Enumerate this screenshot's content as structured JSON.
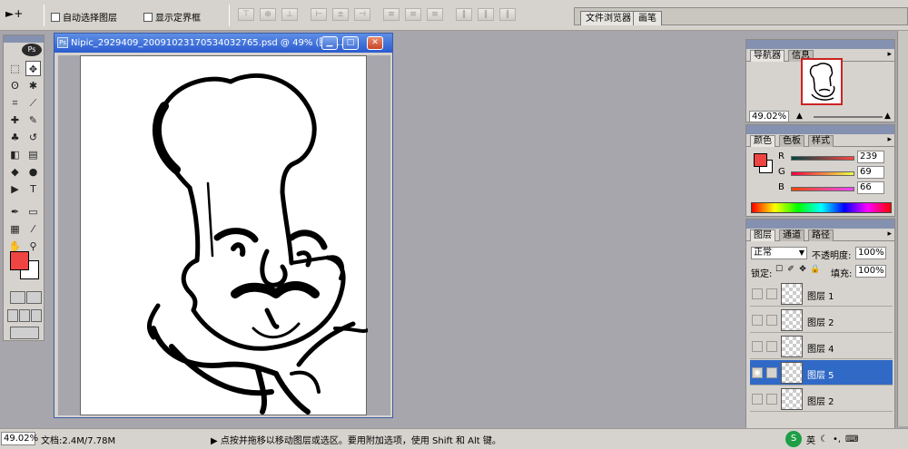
{
  "options_bar": {
    "tool_glyph": "►+",
    "auto_select_label": "自动选择图层",
    "show_bounds_label": "显示定界框",
    "align_buttons": [
      "⊤",
      "⊕",
      "⊥",
      "⊢",
      "±",
      "⊣",
      "≡",
      "≡",
      "≡",
      "‖",
      "‖",
      "‖"
    ],
    "well_tabs": [
      "文件浏览器",
      "画笔"
    ]
  },
  "toolbox": {
    "logo_text": "Ps",
    "tools": [
      {
        "name": "marquee-tool",
        "glyph": "⬚"
      },
      {
        "name": "move-tool",
        "glyph": "✥"
      },
      {
        "name": "lasso-tool",
        "glyph": "ʘ"
      },
      {
        "name": "magic-wand-tool",
        "glyph": "✱"
      },
      {
        "name": "crop-tool",
        "glyph": "⌗"
      },
      {
        "name": "slice-tool",
        "glyph": "⟋"
      },
      {
        "name": "healing-brush-tool",
        "glyph": "✚"
      },
      {
        "name": "brush-tool",
        "glyph": "✎"
      },
      {
        "name": "stamp-tool",
        "glyph": "♣"
      },
      {
        "name": "history-brush-tool",
        "glyph": "↺"
      },
      {
        "name": "eraser-tool",
        "glyph": "◧"
      },
      {
        "name": "gradient-tool",
        "glyph": "▤"
      },
      {
        "name": "blur-tool",
        "glyph": "◆"
      },
      {
        "name": "dodge-tool",
        "glyph": "●"
      },
      {
        "name": "path-selection-tool",
        "glyph": "▶"
      },
      {
        "name": "type-tool",
        "glyph": "T"
      },
      {
        "name": "pen-tool",
        "glyph": "✒"
      },
      {
        "name": "shape-tool",
        "glyph": "▭"
      },
      {
        "name": "notes-tool",
        "glyph": "▦"
      },
      {
        "name": "eyedropper-tool",
        "glyph": "⁄"
      },
      {
        "name": "hand-tool",
        "glyph": "✋"
      },
      {
        "name": "zoom-tool",
        "glyph": "⚲"
      }
    ],
    "foreground_color": "#ef4542",
    "background_color": "#ffffff"
  },
  "document": {
    "title": "Nipic_2929409_20091023170534032765.psd @ 49% (图层...",
    "minimize_glyph": "▁",
    "maximize_glyph": "□",
    "close_glyph": "✕",
    "icon_text": "Ps"
  },
  "navigator": {
    "tabs": [
      "导航器",
      "信息"
    ],
    "zoom": "49.02%"
  },
  "color_panel": {
    "tabs": [
      "颜色",
      "色板",
      "样式"
    ],
    "channels": [
      {
        "label": "R",
        "value": "239"
      },
      {
        "label": "G",
        "value": "69"
      },
      {
        "label": "B",
        "value": "66"
      }
    ]
  },
  "layers_panel": {
    "tabs": [
      "图层",
      "通道",
      "路径"
    ],
    "blend_mode": "正常",
    "opacity_label": "不透明度:",
    "opacity_value": "100%",
    "lock_label": "锁定:",
    "fill_label": "填充:",
    "fill_value": "100%",
    "lock_glyphs": [
      "☐",
      "✐",
      "✥",
      "🔒"
    ],
    "layers": [
      {
        "name": "图层 1",
        "selected": false
      },
      {
        "name": "图层 2",
        "selected": false
      },
      {
        "name": "图层 4",
        "selected": false
      },
      {
        "name": "图层 5",
        "selected": true
      },
      {
        "name": "图层 2",
        "selected": false
      }
    ]
  },
  "status_bar": {
    "zoom": "49.02%",
    "doc_info": "文档:2.4M/7.78M",
    "hint": "▶ 点按并拖移以移动图层或选区。要用附加选项，使用 Shift 和 Alt 键。",
    "tray_ime": "S",
    "tray_lang": "英",
    "tray_moon": "☾",
    "tray_dot": "•,",
    "tray_kbd": "⌨"
  }
}
